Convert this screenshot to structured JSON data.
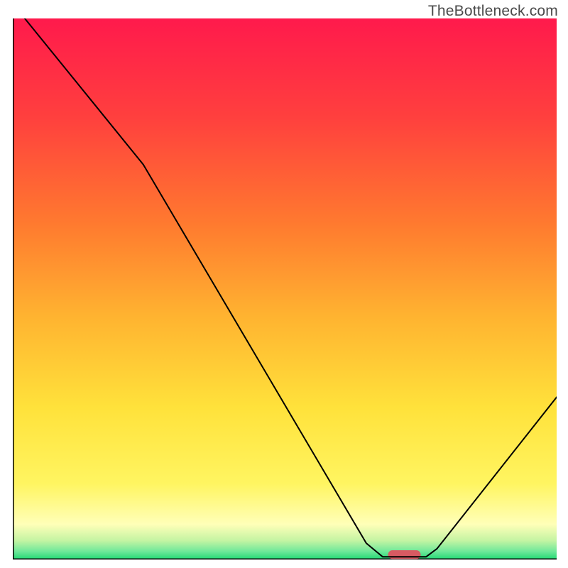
{
  "watermark": "TheBottleneck.com",
  "chart_data": {
    "type": "line",
    "title": "",
    "xlabel": "",
    "ylabel": "",
    "xlim": [
      0,
      100
    ],
    "ylim": [
      0,
      100
    ],
    "grid": false,
    "background_gradient": {
      "stops": [
        {
          "pos": 0.0,
          "color": "#ff1a4c"
        },
        {
          "pos": 0.18,
          "color": "#ff3f3e"
        },
        {
          "pos": 0.38,
          "color": "#ff7a2f"
        },
        {
          "pos": 0.55,
          "color": "#ffb330"
        },
        {
          "pos": 0.72,
          "color": "#ffe23b"
        },
        {
          "pos": 0.86,
          "color": "#fff561"
        },
        {
          "pos": 0.935,
          "color": "#ffffb8"
        },
        {
          "pos": 0.965,
          "color": "#c4f4a3"
        },
        {
          "pos": 0.985,
          "color": "#6fe89a"
        },
        {
          "pos": 1.0,
          "color": "#1fd873"
        }
      ]
    },
    "series": [
      {
        "name": "bottleneck-curve",
        "stroke": "#000000",
        "stroke_width": 2,
        "points": [
          {
            "x": 2.2,
            "y": 100.0
          },
          {
            "x": 24.0,
            "y": 73.0
          },
          {
            "x": 65.0,
            "y": 3.0
          },
          {
            "x": 68.0,
            "y": 0.5
          },
          {
            "x": 76.0,
            "y": 0.5
          },
          {
            "x": 78.0,
            "y": 2.0
          },
          {
            "x": 100.0,
            "y": 30.0
          }
        ]
      }
    ],
    "marker": {
      "name": "optimal-pill",
      "cx": 72.0,
      "cy": 0.9,
      "width": 6.0,
      "height": 1.6,
      "fill": "#d85a62"
    }
  }
}
